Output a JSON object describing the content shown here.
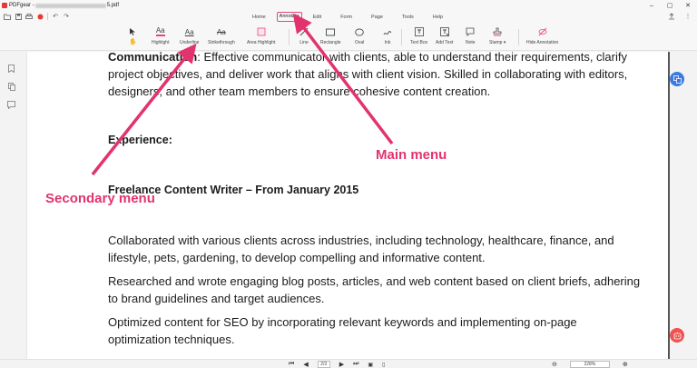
{
  "window": {
    "app_name": "PDFgear",
    "title_prefix": "PDFgear - ",
    "title_suffix": "5.pdf",
    "controls": [
      "–",
      "▢",
      "✕"
    ]
  },
  "menu": {
    "tabs": [
      "Home",
      "Annotate",
      "Edit",
      "Form",
      "Page",
      "Tools",
      "Help"
    ],
    "active_tab": "Annotate"
  },
  "toolbar": {
    "tools": [
      {
        "label": "",
        "icon": "pointer-icon"
      },
      {
        "label": "Highlight",
        "icon": "highlight-icon"
      },
      {
        "label": "Underline",
        "icon": "underline-icon"
      },
      {
        "label": "Strikethrough",
        "icon": "strikethrough-icon"
      },
      {
        "label": "Area Highlight",
        "icon": "area-highlight-icon"
      },
      {
        "label": "Line",
        "icon": "line-icon"
      },
      {
        "label": "Rectangle",
        "icon": "rectangle-icon"
      },
      {
        "label": "Oval",
        "icon": "oval-icon"
      },
      {
        "label": "Ink",
        "icon": "ink-icon"
      },
      {
        "label": "Text Box",
        "icon": "text-box-icon"
      },
      {
        "label": "Add Text",
        "icon": "add-text-icon"
      },
      {
        "label": "Note",
        "icon": "note-icon"
      },
      {
        "label": "Stamp ▾",
        "icon": "stamp-icon"
      },
      {
        "label": "Hide Annotation",
        "icon": "hide-annotation-icon"
      }
    ]
  },
  "document": {
    "lines": [
      {
        "bold_part": "Communication",
        "rest": ": Effective communicator with clients, able to understand their requirements, clarify"
      },
      {
        "text": "project objectives, and deliver work that aligns with client vision. Skilled in collaborating with editors,"
      },
      {
        "text": "designers, and other team members to ensure cohesive content creation."
      },
      {
        "heading": "Experience:"
      },
      {
        "heading": "Freelance Content Writer – From January 2015"
      },
      {
        "text": "Collaborated with various clients across industries, including technology, healthcare, finance, and"
      },
      {
        "text": "lifestyle, pets, gardening, to develop compelling and informative content."
      },
      {
        "text": "Researched and wrote engaging blog posts, articles, and web content based on client briefs, adhering"
      },
      {
        "text": "to brand guidelines and target audiences."
      },
      {
        "text": "Optimized content for SEO by incorporating relevant keywords and implementing on-page"
      },
      {
        "text": "optimization techniques."
      }
    ]
  },
  "annotations": {
    "main_menu_label": "Main menu",
    "secondary_menu_label": "Secondary menu",
    "color": "#e2336f"
  },
  "statusbar": {
    "page_indicator": "2/3",
    "zoom_level": "228%"
  }
}
